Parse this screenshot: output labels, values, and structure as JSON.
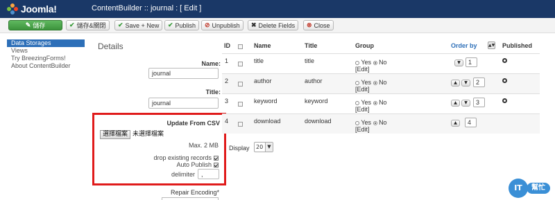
{
  "header": {
    "app_name": "Joomla!",
    "page_title": "ContentBuilder :: journal : [ Edit ]"
  },
  "toolbar": {
    "save": "儲存",
    "save_close": "儲存&關閉",
    "save_new": "Save + New",
    "publish": "Publish",
    "unpublish": "Unpublish",
    "delete_fields": "Delete Fields",
    "close": "Close"
  },
  "sidebar": {
    "items": [
      {
        "label": "Data Storages",
        "active": true
      },
      {
        "label": "Views",
        "active": false
      },
      {
        "label": "Try BreezingForms!",
        "active": false
      },
      {
        "label": "About ContentBuilder",
        "active": false
      }
    ]
  },
  "details": {
    "title": "Details",
    "name_label": "Name:",
    "name_value": "journal",
    "title_label": "Title:",
    "title_value": "journal"
  },
  "csv": {
    "heading": "Update From CSV",
    "file_button": "選擇檔案",
    "file_status": "未選擇檔案",
    "max_size": "Max. 2 MB",
    "drop_existing": "drop existing records",
    "drop_existing_checked": true,
    "auto_publish": "Auto Publish",
    "auto_publish_checked": true,
    "delimiter_label": "delimiter",
    "delimiter_value": ",",
    "repair_label": "Repair Encoding*"
  },
  "table": {
    "headers": {
      "id": "ID",
      "name": "Name",
      "title": "Title",
      "group": "Group",
      "order_by": "Order by",
      "published": "Published"
    },
    "group_yes": "Yes",
    "group_no": "No",
    "group_edit": "[Edit]",
    "rows": [
      {
        "id": "1",
        "name": "title",
        "title": "title",
        "order": "1"
      },
      {
        "id": "2",
        "name": "author",
        "title": "author",
        "order": "2"
      },
      {
        "id": "3",
        "name": "keyword",
        "title": "keyword",
        "order": "3"
      },
      {
        "id": "4",
        "name": "download",
        "title": "download",
        "order": "4"
      }
    ]
  },
  "display": {
    "label": "Display",
    "value": "20"
  },
  "watermark": {
    "badge": "IT",
    "text": "幫忙"
  },
  "colors": {
    "header_bg": "#1a3867",
    "save_green": "#46a546",
    "link_blue": "#2d6fb8",
    "highlight_red": "#e01b1b"
  }
}
